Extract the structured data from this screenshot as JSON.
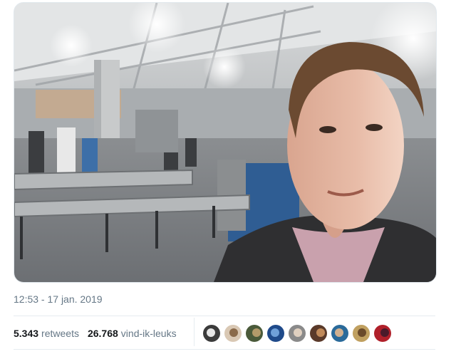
{
  "tweet": {
    "timestamp": "12:53 - 17 jan. 2019",
    "retweets": {
      "count": "5.343",
      "label": "retweets"
    },
    "likes": {
      "count": "26.768",
      "label": "vind-ik-leuks"
    }
  },
  "photo": {
    "icon": "selfie-photo"
  },
  "likers": [
    {
      "name": "liker-avatar-1",
      "bg": "#3b3b3b",
      "fg": "#e6e6e6"
    },
    {
      "name": "liker-avatar-2",
      "bg": "#d9c8b4",
      "fg": "#8a6a4a"
    },
    {
      "name": "liker-avatar-3",
      "bg": "#4a5a3a",
      "fg": "#b39a6a"
    },
    {
      "name": "liker-avatar-4",
      "bg": "#1f4a8a",
      "fg": "#6fa0d8"
    },
    {
      "name": "liker-avatar-5",
      "bg": "#8a8a8a",
      "fg": "#e0d0c0"
    },
    {
      "name": "liker-avatar-6",
      "bg": "#5a3a2a",
      "fg": "#c08a5a"
    },
    {
      "name": "liker-avatar-7",
      "bg": "#2a6a9a",
      "fg": "#d0b090"
    },
    {
      "name": "liker-avatar-8",
      "bg": "#c0a060",
      "fg": "#6a4a2a"
    },
    {
      "name": "liker-avatar-9",
      "bg": "#b0202a",
      "fg": "#4a1a2a"
    }
  ]
}
